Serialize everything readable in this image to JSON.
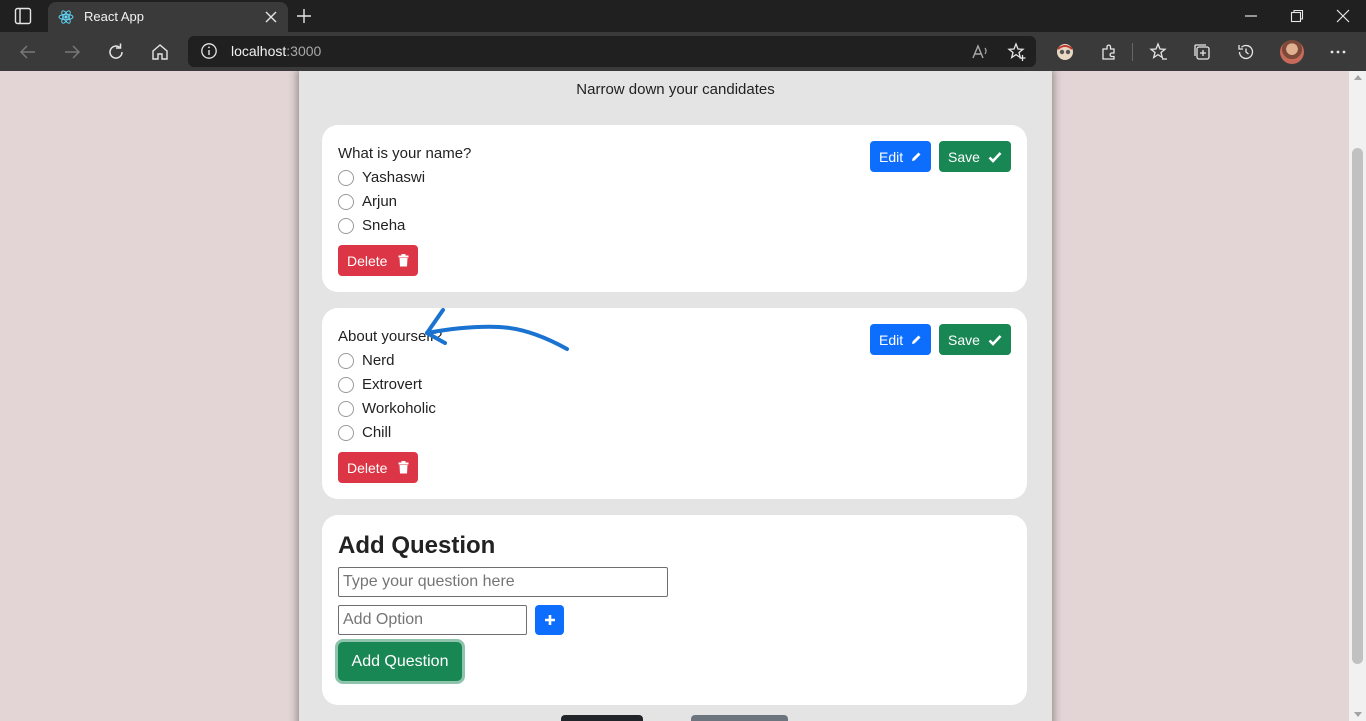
{
  "browser": {
    "tab_title": "React App",
    "url_host": "localhost",
    "url_port": ":3000"
  },
  "page": {
    "subtitle": "Narrow down your candidates",
    "questions": [
      {
        "question": "What is your name?",
        "options": [
          "Yashaswi",
          "Arjun",
          "Sneha"
        ],
        "edit_label": "Edit",
        "save_label": "Save",
        "delete_label": "Delete"
      },
      {
        "question": "About yourself?",
        "options": [
          "Nerd",
          "Extrovert",
          "Workoholic",
          "Chill"
        ],
        "edit_label": "Edit",
        "save_label": "Save",
        "delete_label": "Delete"
      }
    ],
    "add_form": {
      "heading": "Add Question",
      "question_placeholder": "Type your question here",
      "option_placeholder": "Add Option",
      "submit_label": "Add Question"
    }
  },
  "colors": {
    "edit": "#0d6efd",
    "save": "#198754",
    "delete": "#dc3545",
    "annotation_arrow": "#1a73d1",
    "page_background": "#e3d5d6"
  },
  "icons": {
    "edit": "pencil-icon",
    "save": "check-icon",
    "delete": "trash-icon",
    "add_option": "plus-icon"
  }
}
